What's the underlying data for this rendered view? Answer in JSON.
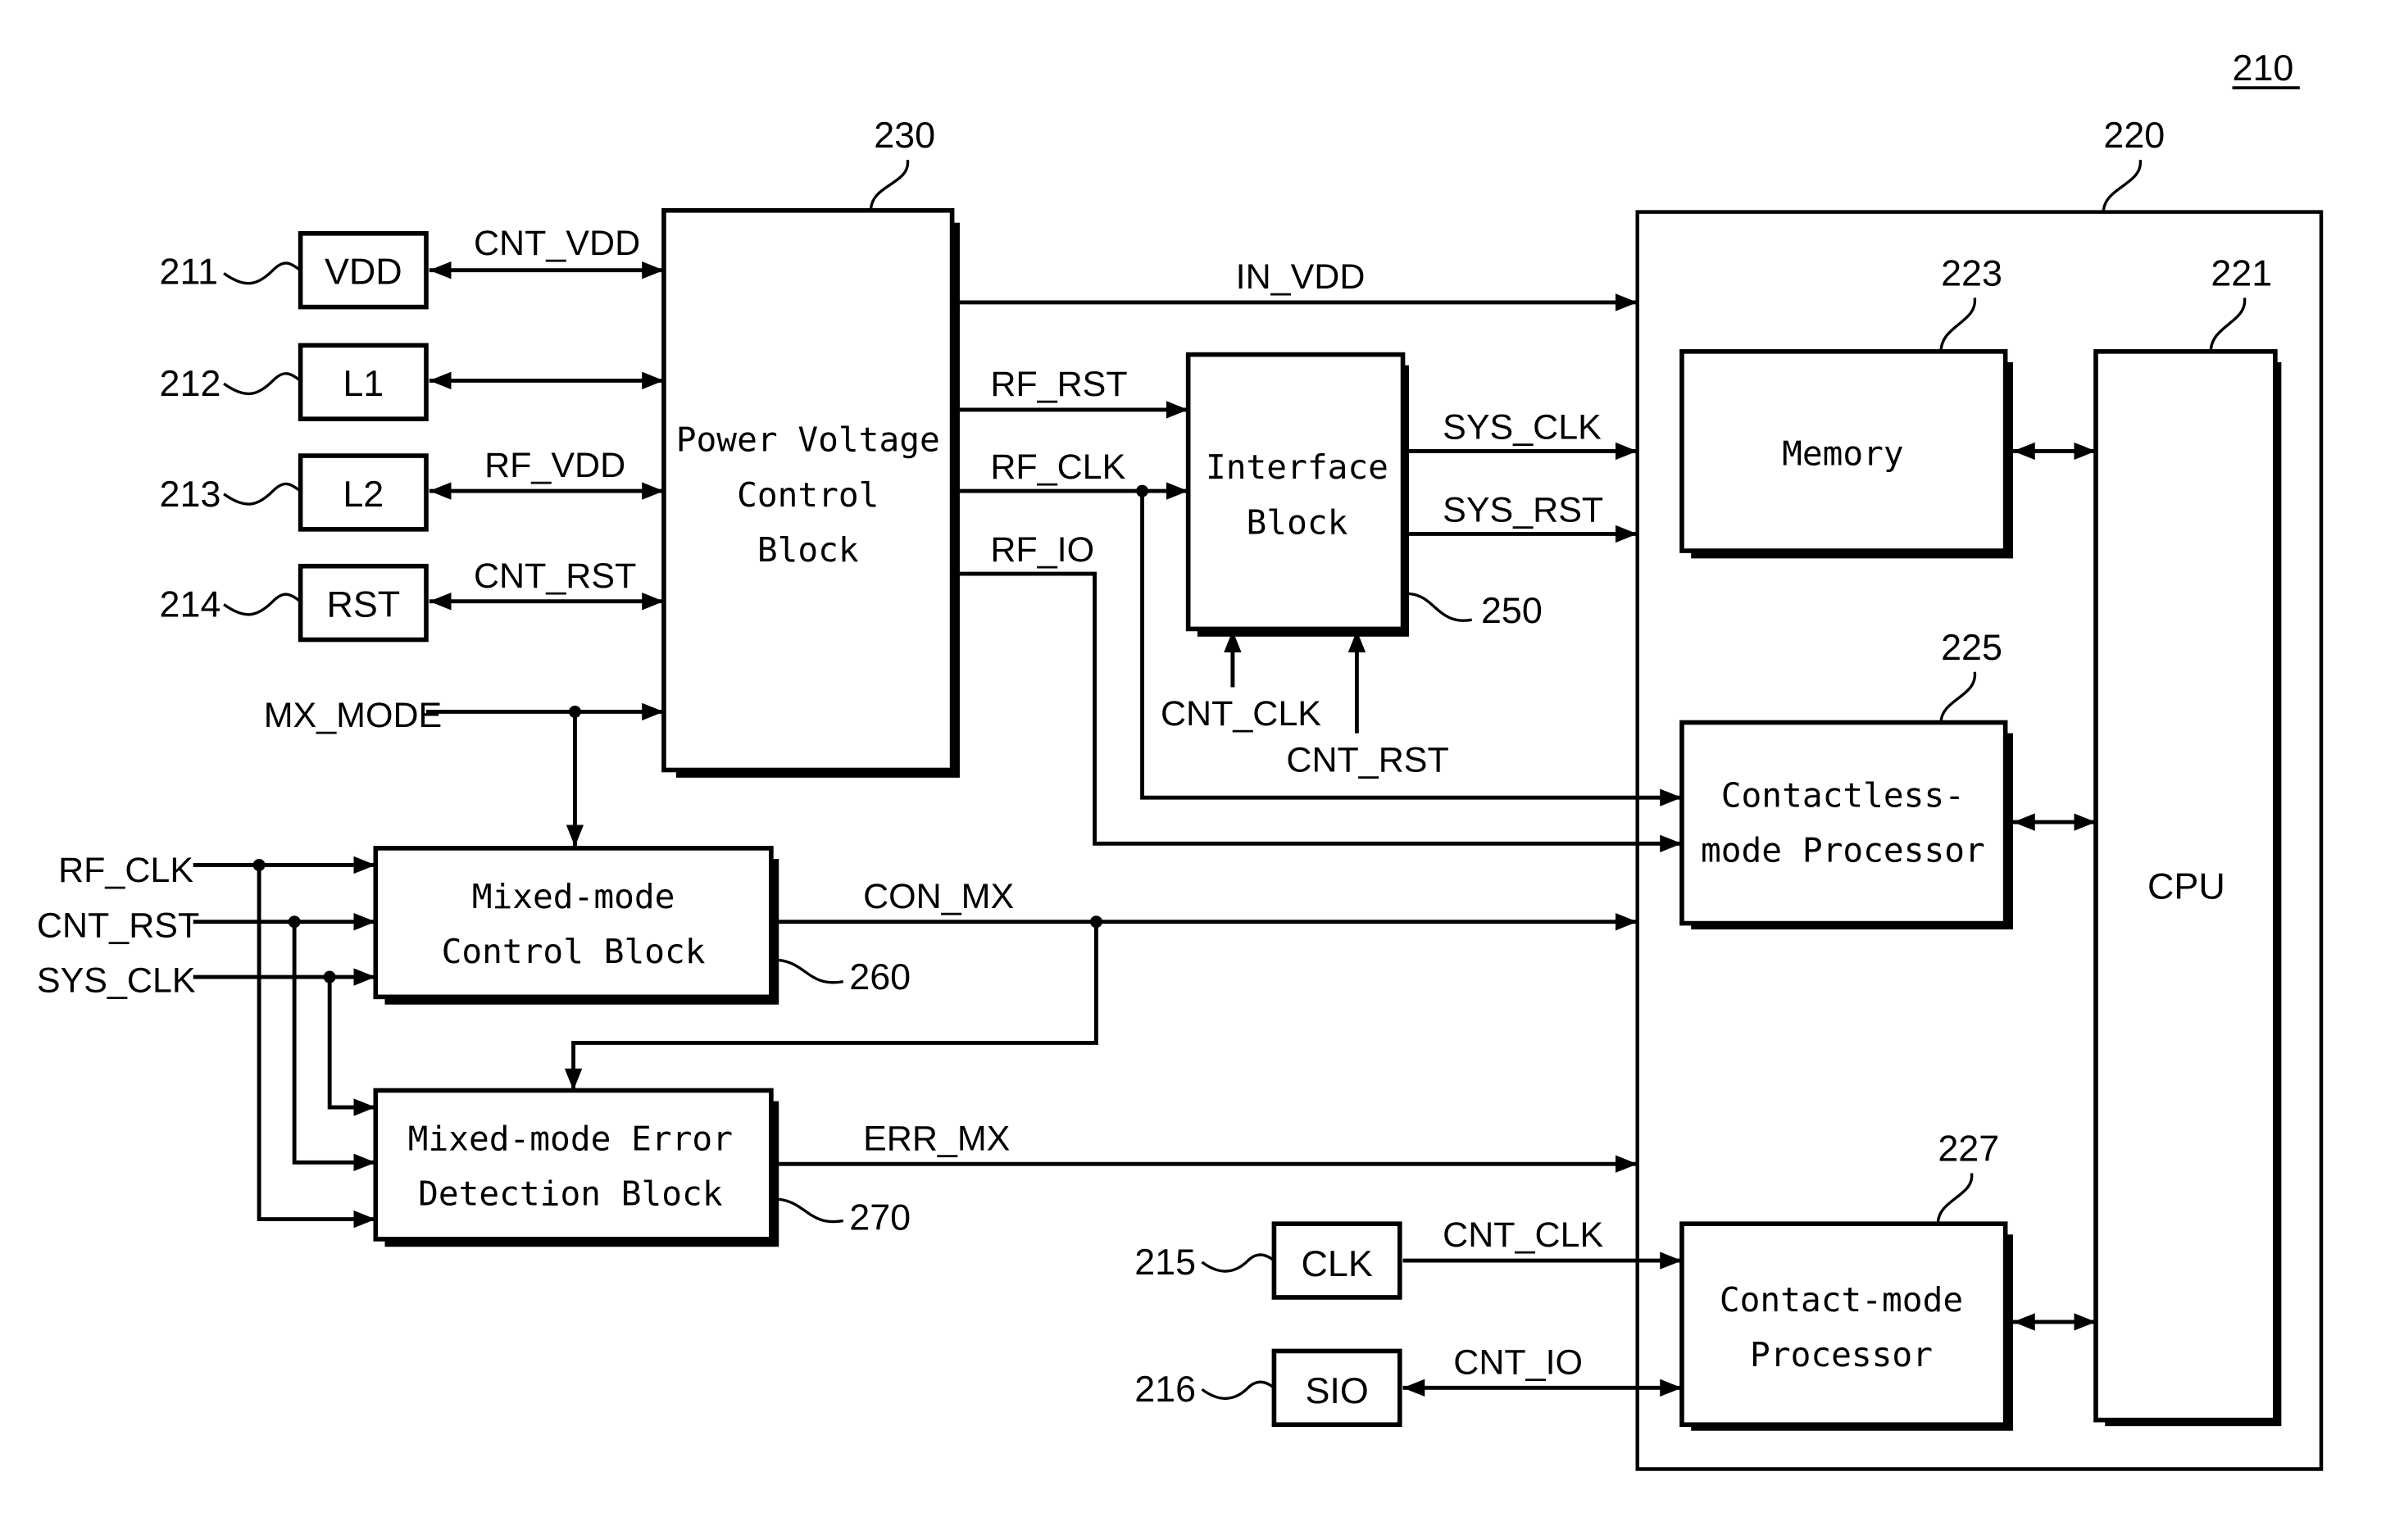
{
  "figure": {
    "ref": "210",
    "outer_ref": "220"
  },
  "pads": [
    {
      "ref": "211",
      "label": "VDD",
      "signal": "CNT_VDD"
    },
    {
      "ref": "212",
      "label": "L1",
      "signal": ""
    },
    {
      "ref": "213",
      "label": "L2",
      "signal": "RF_VDD"
    },
    {
      "ref": "214",
      "label": "RST",
      "signal": "CNT_RST"
    },
    {
      "ref": "215",
      "label": "CLK",
      "signal": "CNT_CLK"
    },
    {
      "ref": "216",
      "label": "SIO",
      "signal": "CNT_IO"
    }
  ],
  "blocks": {
    "power": {
      "ref": "230",
      "lines": [
        "Power Voltage",
        "Control",
        "Block"
      ]
    },
    "interface": {
      "ref": "250",
      "lines": [
        "Interface",
        "Block"
      ]
    },
    "mixed_control": {
      "ref": "260",
      "lines": [
        "Mixed-mode",
        "Control Block"
      ]
    },
    "mixed_error": {
      "ref": "270",
      "lines": [
        "Mixed-mode Error",
        "Detection Block"
      ]
    },
    "memory": {
      "ref": "223",
      "lines": [
        "Memory"
      ]
    },
    "contactless": {
      "ref": "225",
      "lines": [
        "Contactless-",
        "mode Processor"
      ]
    },
    "contact": {
      "ref": "227",
      "lines": [
        "Contact-mode",
        "Processor"
      ]
    },
    "cpu": {
      "ref": "221",
      "lines": [
        "CPU"
      ]
    }
  },
  "signals": {
    "mx_mode": "MX_MODE",
    "in_vdd": "IN_VDD",
    "rf_rst": "RF_RST",
    "rf_clk": "RF_CLK",
    "rf_io": "RF_IO",
    "sys_clk": "SYS_CLK",
    "sys_rst": "SYS_RST",
    "cnt_clk": "CNT_CLK",
    "cnt_rst": "CNT_RST",
    "con_mx": "CON_MX",
    "err_mx": "ERR_MX",
    "in_rf_clk": "RF_CLK",
    "in_cnt_rst": "CNT_RST",
    "in_sys_clk": "SYS_CLK"
  }
}
